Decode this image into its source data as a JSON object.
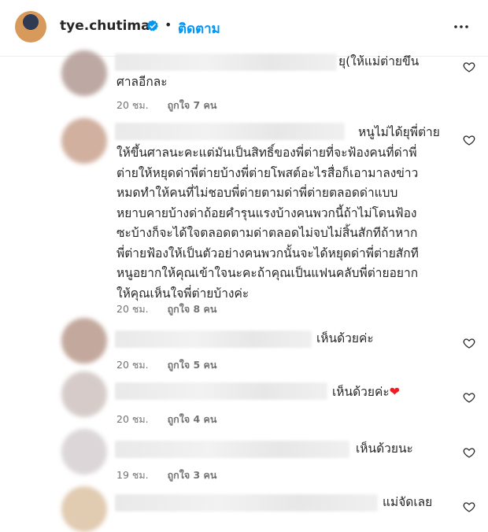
{
  "header": {
    "username": "tye.chutima",
    "separator": "•",
    "follow_label": "ติดตาม"
  },
  "comments": [
    {
      "text_after_name": "ยุ(ให้แม่ต่ายขึน\nศาลอีกละ",
      "time": "20 ชม.",
      "likes": "ถูกใจ 7 คน"
    },
    {
      "text_after_name": "หนูไม่ได้ยุพี่ต่าย",
      "text_body": "ให้ขึ้นศาลนะคะแต่มันเป็นสิทธิ์ของพี่ต่ายที่จะฟ้องคนที่ด่าพี่\nต่ายให้หยุดด่าพี่ต่ายบ้างพี่ต่ายโพสต์อะไรสื่อก็เอามาลงข่าว\nหมดทำให้คนที่ไม่ชอบพี่ต่ายตามด่าพี่ต่ายตลอดด่าแบบ\nหยาบคายบ้างด่าถ้อยคำรุนแรงบ้างคนพวกนี้ถ้าไม่โดนฟ้อง\nซะบ้างก็จะได้ใจตลอดตามด่าตลอดไม่จบไม่สิ้นสักทีถ้าหาก\nพี่ต่ายฟ้องให้เป็นตัวอย่างคนพวกนั้นจะได้หยุดด่าพี่ต่ายสักที\nหนูอยากให้คุณเข้าใจนะคะถ้าคุณเป็นแฟนคลับพี่ต่ายอยาก\nให้คุณเห็นใจพี่ต่ายบ้างค่ะ",
      "time": "20 ชม.",
      "likes": "ถูกใจ 8 คน"
    },
    {
      "text_after_name": "เห็นด้วยค่ะ",
      "time": "20 ชม.",
      "likes": "ถูกใจ 5 คน"
    },
    {
      "text_after_name": "เห็นด้วยค่ะ",
      "emoji": "❤",
      "time": "20 ชม.",
      "likes": "ถูกใจ 4 คน"
    },
    {
      "text_after_name": "เห็นด้วยนะ",
      "time": "19 ชม.",
      "likes": "ถูกใจ 3 คน"
    },
    {
      "text_after_name": "แม่จัดเลย"
    }
  ]
}
